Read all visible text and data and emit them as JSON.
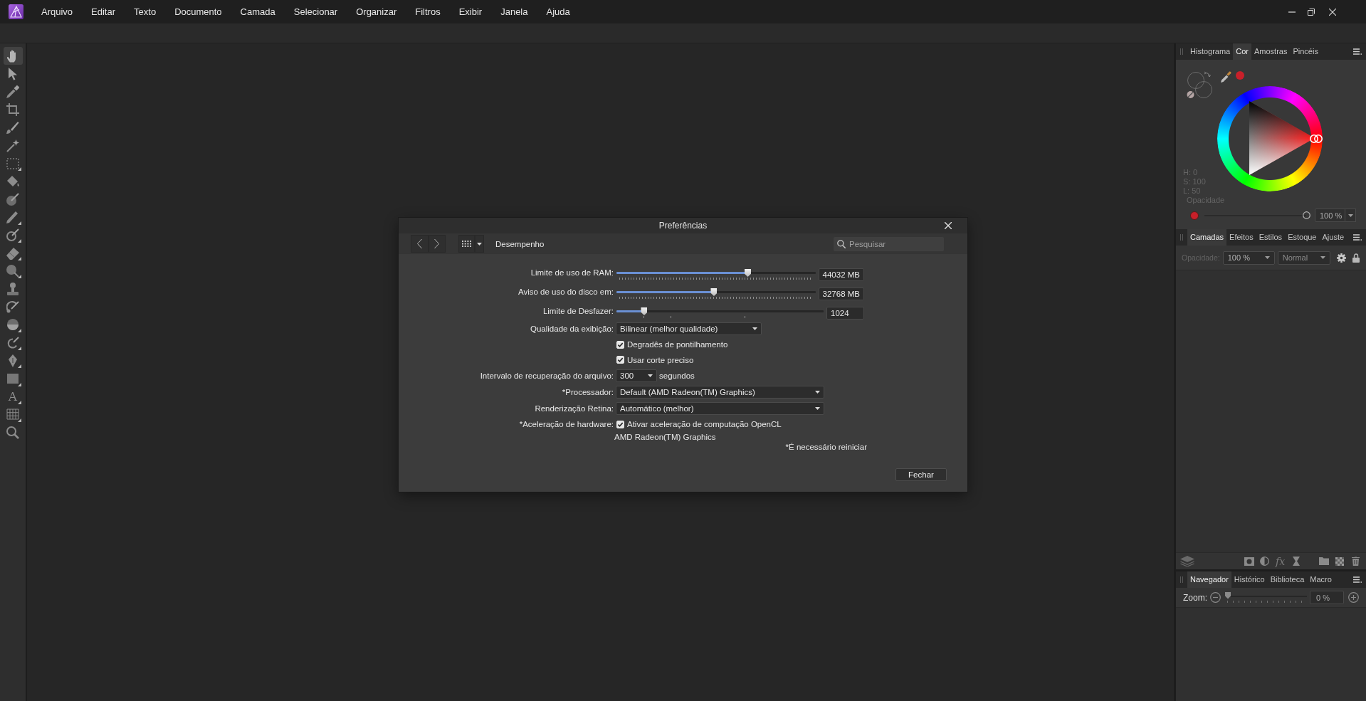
{
  "menu_bar": {
    "items": [
      "Arquivo",
      "Editar",
      "Texto",
      "Documento",
      "Camada",
      "Selecionar",
      "Organizar",
      "Filtros",
      "Exibir",
      "Janela",
      "Ajuda"
    ]
  },
  "tools": [
    {
      "kind": "hand",
      "selected": true,
      "flyout": false
    },
    {
      "kind": "pointer",
      "selected": false,
      "flyout": false
    },
    {
      "kind": "eyedropper",
      "selected": false,
      "flyout": false
    },
    {
      "kind": "crop",
      "selected": false,
      "flyout": false
    },
    {
      "kind": "selection-brush",
      "selected": false,
      "flyout": false
    },
    {
      "kind": "wand",
      "selected": false,
      "flyout": false
    },
    {
      "kind": "marquee",
      "selected": false,
      "flyout": true
    },
    {
      "kind": "bucket",
      "selected": false,
      "flyout": false
    },
    {
      "kind": "disc-brush",
      "selected": false,
      "flyout": false
    },
    {
      "kind": "paintbrush",
      "selected": false,
      "flyout": true
    },
    {
      "kind": "ring-brush",
      "selected": false,
      "flyout": true
    },
    {
      "kind": "eraser",
      "selected": false,
      "flyout": true
    },
    {
      "kind": "round-brush",
      "selected": false,
      "flyout": true
    },
    {
      "kind": "stamp",
      "selected": false,
      "flyout": false
    },
    {
      "kind": "arc-brush",
      "selected": false,
      "flyout": false
    },
    {
      "kind": "dodge",
      "selected": false,
      "flyout": true
    },
    {
      "kind": "hook-brush",
      "selected": false,
      "flyout": true
    },
    {
      "kind": "pen",
      "selected": false,
      "flyout": true
    },
    {
      "kind": "rectangle",
      "selected": false,
      "flyout": true
    },
    {
      "kind": "text",
      "glyph": "A",
      "selected": false,
      "flyout": true
    },
    {
      "kind": "mesh",
      "selected": false,
      "flyout": true
    },
    {
      "kind": "zoom",
      "selected": false,
      "flyout": false
    }
  ],
  "dialog": {
    "title": "Preferências",
    "section": "Desempenho",
    "search": {
      "placeholder": "Pesquisar"
    },
    "rows": [
      {
        "kind": "slider",
        "label": "Limite de uso de RAM:",
        "level": 0.66,
        "value": "44032 MB"
      },
      {
        "kind": "slider",
        "label": "Aviso de uso do disco em:",
        "level": 0.49,
        "value": "32768 MB"
      },
      {
        "kind": "log-slider",
        "label": "Limite de Desfazer:",
        "level": 0.134,
        "value": "1024"
      },
      {
        "kind": "dropdown",
        "label": "Qualidade da exibição:",
        "value": "Bilinear (melhor qualidade)"
      },
      {
        "kind": "checkbox",
        "text": "Degradês de pontilhamento",
        "checked": true
      },
      {
        "kind": "checkbox",
        "text": "Usar corte preciso",
        "checked": true
      },
      {
        "kind": "dropdown",
        "label": "Intervalo de recuperação do arquivo:",
        "value": "300",
        "suffix": "segundos"
      },
      {
        "kind": "dropdown",
        "label": "*Processador:",
        "value": "Default (AMD Radeon(TM) Graphics)"
      },
      {
        "kind": "dropdown",
        "label": "Renderização Retina:",
        "value": "Automático (melhor)"
      },
      {
        "kind": "checkbox",
        "label": "*Aceleração de hardware:",
        "text": "Ativar aceleração de computação OpenCL",
        "checked": true
      },
      {
        "kind": "note",
        "text": "AMD Radeon(TM) Graphics"
      }
    ],
    "restart_note": "*É necessário reiniciar",
    "buttons": [
      "Fechar"
    ]
  },
  "color_panel": {
    "tabs": [
      {
        "label": "Histograma",
        "selected": false
      },
      {
        "label": "Cor",
        "selected": true
      },
      {
        "label": "Amostras",
        "selected": false
      },
      {
        "label": "Pincéis",
        "selected": false
      }
    ],
    "readouts": [
      "H: 0",
      "S: 100",
      "L: 50"
    ],
    "opacity_label": "Opacidade",
    "opacity": {
      "level": 1,
      "value": "100 %"
    }
  },
  "layers_panel": {
    "tabs": [
      {
        "label": "Camadas",
        "selected": true
      },
      {
        "label": "Efeitos",
        "selected": false
      },
      {
        "label": "Estilos",
        "selected": false
      },
      {
        "label": "Estoque",
        "selected": false
      },
      {
        "label": "Ajuste",
        "selected": false
      }
    ],
    "opacity_label": "Opacidade:",
    "opacity_value": "100 %",
    "blend_mode": "Normal",
    "fx_label": "fx"
  },
  "navigator_panel": {
    "tabs": [
      {
        "label": "Navegador",
        "selected": true
      },
      {
        "label": "Histórico",
        "selected": false
      },
      {
        "label": "Biblioteca",
        "selected": false
      },
      {
        "label": "Macro",
        "selected": false
      }
    ],
    "zoom_label": "Zoom:",
    "zoom": {
      "level": 0,
      "value": "0 %"
    }
  }
}
